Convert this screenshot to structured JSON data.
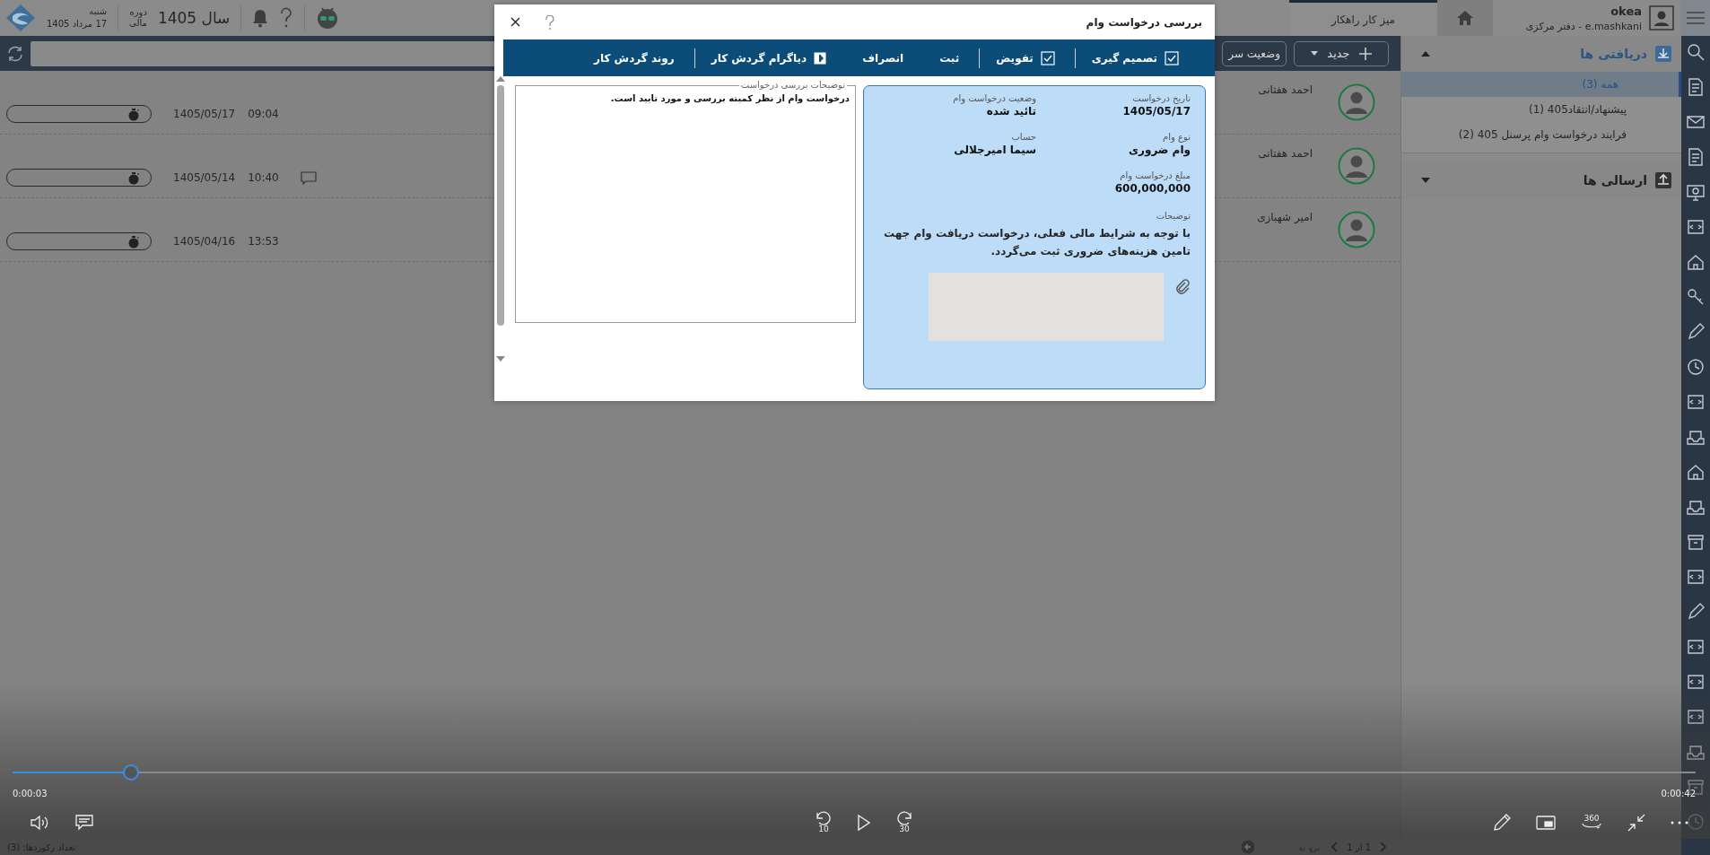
{
  "top_bar": {
    "date": {
      "weekday": "شنبه",
      "date": "17 مرداد 1405"
    },
    "fiscal": {
      "label_lines": [
        "دوره",
        "مالی"
      ],
      "year": "سال 1405"
    },
    "tabs": [
      {
        "label": "میز کار راهکار",
        "selected": true
      }
    ],
    "user": {
      "name": "okea",
      "subtitle": "e.mashkani - دفتر مرکزی"
    }
  },
  "toolbar": {
    "new_button": "جدید",
    "status_button": "وضعیت سر"
  },
  "rows": [
    {
      "name": "احمد هفتانی",
      "date": "1405/05/17",
      "time": "09:04",
      "has_comment": false
    },
    {
      "name": "احمد هفتانی",
      "date": "1405/05/14",
      "time": "10:40",
      "has_comment": true
    },
    {
      "name": "امیر شهبازی",
      "date": "1405/04/16",
      "time": "13:53",
      "has_comment": false
    }
  ],
  "footer": {
    "record_count": "تعداد رکوردها: (3)",
    "pager": "1 از 1",
    "goto_placeholder": "برو به"
  },
  "sidebar": {
    "groups": [
      {
        "label": "دریافتی ها",
        "expanded": true,
        "items": [
          {
            "label": "همه (3)",
            "selected": true
          },
          {
            "label": "پیشنهاد/انتقاد405 (1)",
            "selected": false
          },
          {
            "label": "فرایند درخواست وام پرسنل 405 (2)",
            "selected": false
          }
        ]
      },
      {
        "label": "ارسالی ها",
        "expanded": false
      }
    ]
  },
  "dialog": {
    "title": "بررسی درخواست وام",
    "action_groups": [
      [
        {
          "label": "تصمیم گیری",
          "kind": "check"
        }
      ],
      [
        {
          "label": "تفویض",
          "kind": "check"
        }
      ],
      [
        {
          "label": "ثبت",
          "kind": "plain"
        },
        {
          "label": "انصراف",
          "kind": "plain"
        },
        {
          "label": "دیاگرام گردش کار",
          "kind": "panel"
        }
      ],
      [
        {
          "label": "روند گردش کار",
          "kind": "plain"
        }
      ]
    ],
    "review": {
      "legend": "توضیحات بررسی درخواست",
      "value": "درخواست وام از نظر کمیته بررسی و مورد تایید است."
    },
    "details": {
      "fields": [
        {
          "label": "تاریخ درخواست",
          "value": "1405/05/17"
        },
        {
          "label": "وضعیت درخواست وام",
          "value": "تائید شده"
        },
        {
          "label": "نوع وام",
          "value": "وام ضروری"
        },
        {
          "label": "حساب",
          "value": "سیما امیرجلالی"
        },
        {
          "label": "مبلغ درخواست وام",
          "value": "600,000,000"
        }
      ],
      "description_label": "توضیحات",
      "description": "با توجه به شرایط مالی فعلی، درخواست دریافت وام جهت تامین هزینه‌های ضروری ثبت می‌گردد."
    }
  },
  "player": {
    "level": 0.07,
    "elapsed": "0:00:03",
    "duration": "0:00:42",
    "skip_back": "10",
    "skip_forward": "30",
    "view_360": "360"
  }
}
